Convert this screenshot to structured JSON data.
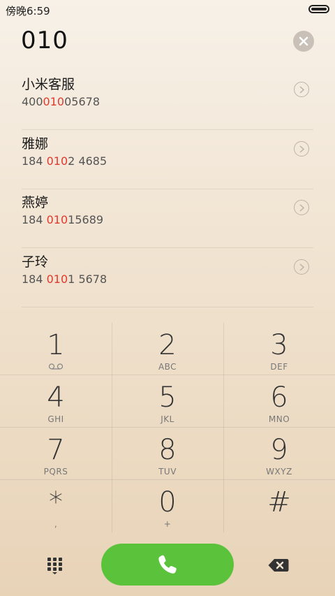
{
  "status_bar": {
    "time": "傍晚6:59"
  },
  "dialer": {
    "input_value": "010"
  },
  "contacts": [
    {
      "name": "小米客服",
      "number_pre": "400",
      "number_hl": "010",
      "number_post": "05678"
    },
    {
      "name": "雅娜",
      "number_pre": "184 ",
      "number_hl": "010",
      "number_post": "2 4685"
    },
    {
      "name": "燕婷",
      "number_pre": "184 ",
      "number_hl": "010",
      "number_post": "15689"
    },
    {
      "name": "子玲",
      "number_pre": "184 ",
      "number_hl": "010",
      "number_post": "1 5678"
    }
  ],
  "keypad": [
    {
      "digit": "1",
      "letters": ""
    },
    {
      "digit": "2",
      "letters": "ABC"
    },
    {
      "digit": "3",
      "letters": "DEF"
    },
    {
      "digit": "4",
      "letters": "GHI"
    },
    {
      "digit": "5",
      "letters": "JKL"
    },
    {
      "digit": "6",
      "letters": "MNO"
    },
    {
      "digit": "7",
      "letters": "PQRS"
    },
    {
      "digit": "8",
      "letters": "TUV"
    },
    {
      "digit": "9",
      "letters": "WXYZ"
    },
    {
      "digit": "*",
      "letters": ","
    },
    {
      "digit": "0",
      "letters": "+"
    },
    {
      "digit": "#",
      "letters": ""
    }
  ],
  "icons": {
    "voicemail": "voicemail-icon",
    "call": "phone-icon",
    "keypad": "keypad-grid-icon",
    "backspace": "backspace-icon",
    "clear": "close-icon",
    "detail": "chevron-right-icon"
  },
  "colors": {
    "call_button": "#5bc23b",
    "highlight": "#e03a2e"
  }
}
